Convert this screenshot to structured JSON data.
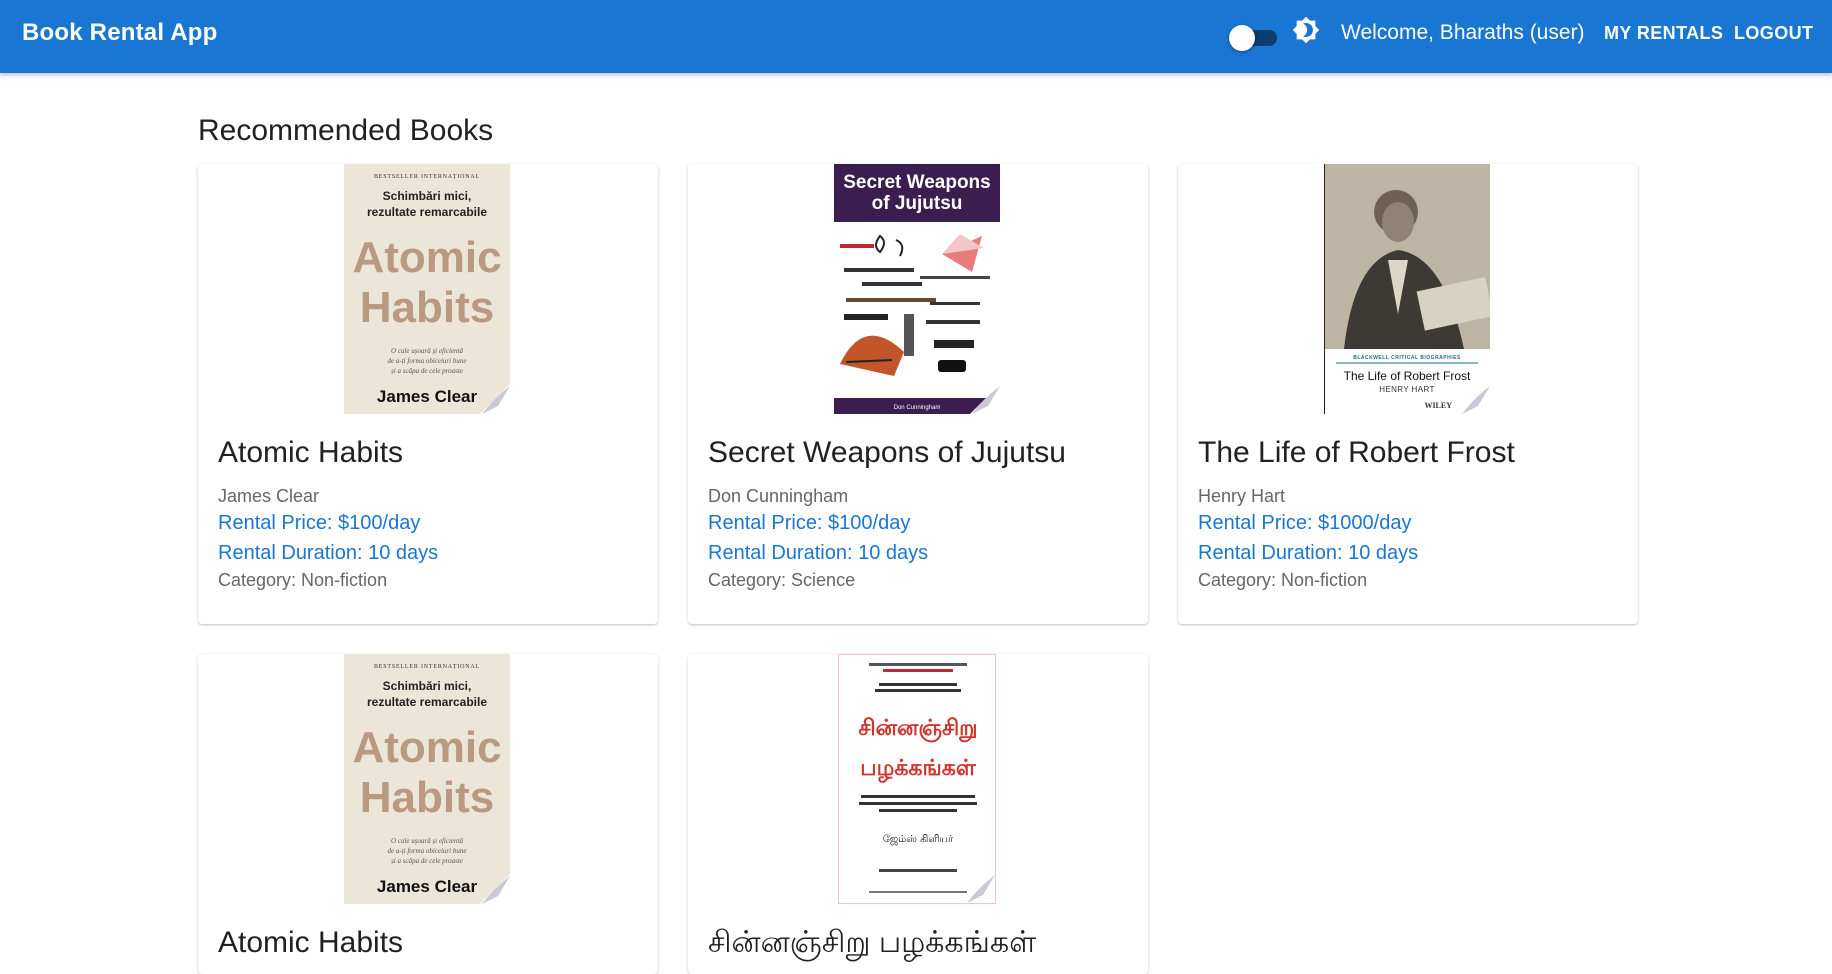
{
  "header": {
    "title": "Book Rental App",
    "welcome": "Welcome, Bharaths (user)",
    "nav_rentals": "MY RENTALS",
    "nav_logout": "LOGOUT",
    "theme_toggle_icon": "brightness-icon",
    "accent": "#1976d2"
  },
  "section": {
    "title": "Recommended Books"
  },
  "books": [
    {
      "title": "Atomic Habits",
      "author": "James Clear",
      "price": "Rental Price: $100/day",
      "duration": "Rental Duration: 10 days",
      "category": "Category: Non-fiction",
      "cover": {
        "top_line": "BESTSELLER INTERNAȚIONAL",
        "subtitle_1": "Schimbări mici,",
        "subtitle_2": "rezultate remarcabile",
        "word_1": "Atomic",
        "word_2": "Habits",
        "tag_1": "O cale ușoară și eficientă",
        "tag_2": "de a-ți forma obiceiuri bune",
        "tag_3": "și a scăpa de cele proaste",
        "author": "James Clear"
      }
    },
    {
      "title": "Secret Weapons of Jujutsu",
      "author": "Don Cunningham",
      "price": "Rental Price: $100/day",
      "duration": "Rental Duration: 10 days",
      "category": "Category: Science",
      "cover": {
        "line_1": "Secret Weapons",
        "line_2": "of Jujutsu",
        "author": "Don Cunningham"
      }
    },
    {
      "title": "The Life of Robert Frost",
      "author": "Henry Hart",
      "price": "Rental Price: $1000/day",
      "duration": "Rental Duration: 10 days",
      "category": "Category: Non-fiction",
      "cover": {
        "series": "BLACKWELL CRITICAL BIOGRAPHIES",
        "title": "The Life of Robert Frost",
        "author": "HENRY HART",
        "publisher": "WILEY"
      }
    },
    {
      "title": "Atomic Habits",
      "cover": {
        "top_line": "BESTSELLER INTERNAȚIONAL",
        "subtitle_1": "Schimbări mici,",
        "subtitle_2": "rezultate remarcabile",
        "word_1": "Atomic",
        "word_2": "Habits",
        "tag_1": "O cale ușoară și eficientă",
        "tag_2": "de a-ți forma obiceiuri bune",
        "tag_3": "și a scăpa de cele proaste",
        "author": "James Clear"
      }
    },
    {
      "title": "சின்னஞ்சிறு பழக்கங்கள்",
      "cover": {
        "title_1": "சின்னஞ்சிறு",
        "title_2": "பழக்கங்கள்",
        "author": "ஜேம்ஸ் கிளியர்"
      }
    }
  ]
}
